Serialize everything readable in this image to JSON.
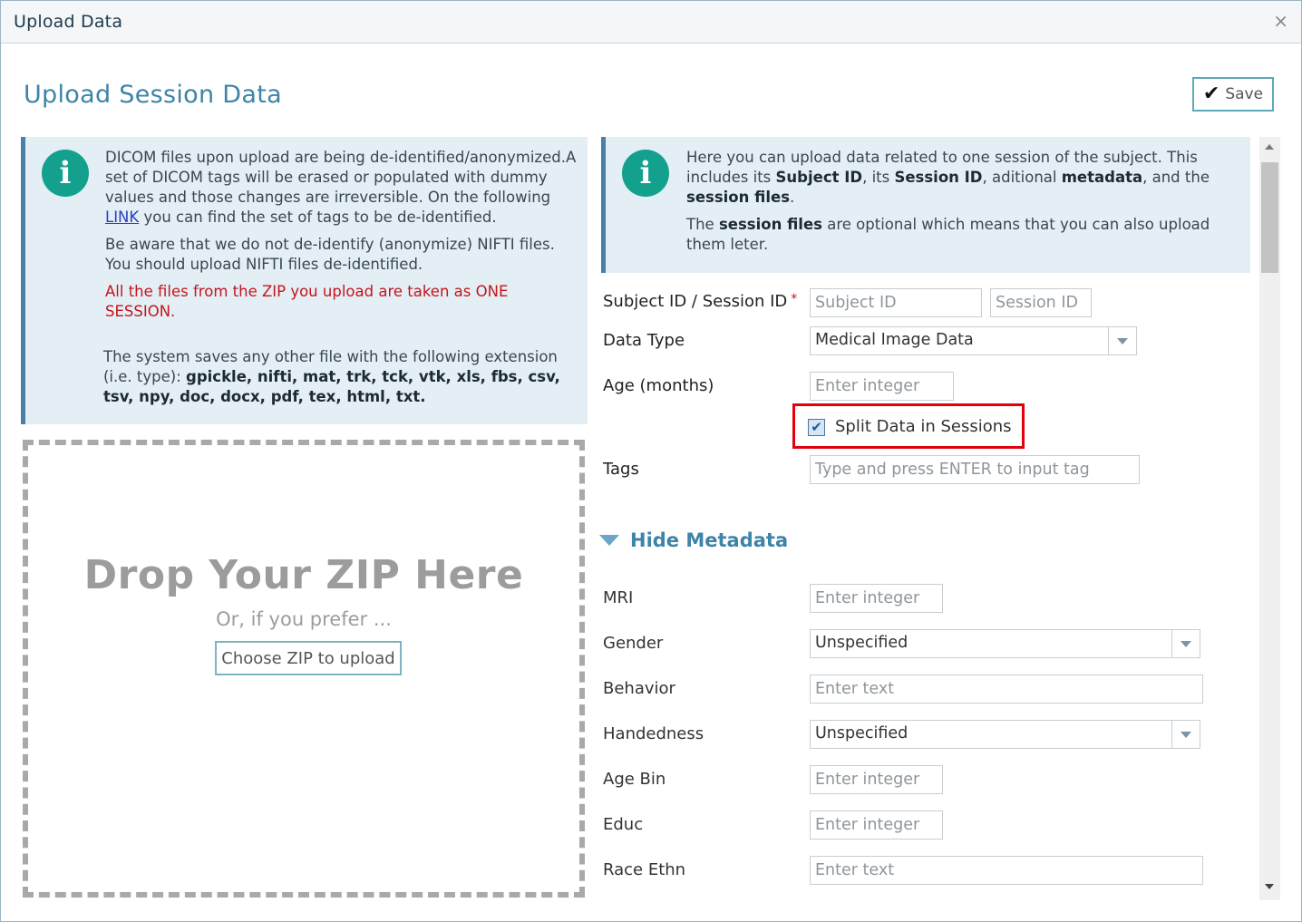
{
  "window": {
    "title": "Upload Data",
    "close_glyph": "×"
  },
  "page": {
    "title": "Upload Session Data",
    "save_label": "Save"
  },
  "left_info": {
    "p1_a": "DICOM files upon upload are being de-identified/anonymized.A set of DICOM tags will be erased or populated with dummy values and those changes are irreversible. On the following ",
    "p1_link": "LINK",
    "p1_b": " you can find the set of tags to be de-identified.",
    "p2": "Be aware that we do not de-identify (anonymize) NIFTI files. You should upload NIFTI files de-identified.",
    "p3": "All the files from the ZIP you upload are taken as ONE SESSION.",
    "p4_a": "The system saves any other file with the following extension (i.e. type): ",
    "p4_b": "gpickle, nifti, mat, trk, tck, vtk, xls, fbs, csv, tsv, npy, doc, docx, pdf, tex, html, txt."
  },
  "right_info": {
    "p1_a": "Here you can upload data related to one session of the subject. This includes its ",
    "p1_b": "Subject ID",
    "p1_c": ", its ",
    "p1_d": "Session ID",
    "p1_e": ", aditional ",
    "p1_f": "metadata",
    "p1_g": ", and the ",
    "p1_h": "session files",
    "p1_i": ".",
    "p2_a": "The ",
    "p2_b": "session files",
    "p2_c": " are optional which means that you can also upload them leter."
  },
  "dropzone": {
    "title": "Drop Your ZIP Here",
    "subtitle": "Or, if you prefer ...",
    "button": "Choose ZIP to upload"
  },
  "form": {
    "subject_session_label": "Subject ID / Session ID",
    "required_mark": "*",
    "subject_placeholder": "Subject ID",
    "session_placeholder": "Session ID",
    "data_type_label": "Data Type",
    "data_type_value": "Medical Image Data",
    "age_label": "Age (months)",
    "age_placeholder": "Enter integer",
    "split_label": "Split Data in Sessions",
    "split_checked": true,
    "split_check_glyph": "✔",
    "tags_label": "Tags",
    "tags_placeholder": "Type and press ENTER to input tag"
  },
  "metadata": {
    "toggle_label": "Hide Metadata",
    "mri_label": "MRI",
    "mri_placeholder": "Enter integer",
    "gender_label": "Gender",
    "gender_value": "Unspecified",
    "behavior_label": "Behavior",
    "behavior_placeholder": "Enter text",
    "handedness_label": "Handedness",
    "handedness_value": "Unspecified",
    "age_bin_label": "Age Bin",
    "age_bin_placeholder": "Enter integer",
    "educ_label": "Educ",
    "educ_placeholder": "Enter integer",
    "race_label": "Race Ethn",
    "race_placeholder": "Enter text"
  },
  "colors": {
    "accent": "#3d84a8",
    "info_bg": "#e4eef5",
    "icon_green": "#13a18e",
    "warning_red": "#c4151c",
    "highlight_red": "#e3000b"
  }
}
